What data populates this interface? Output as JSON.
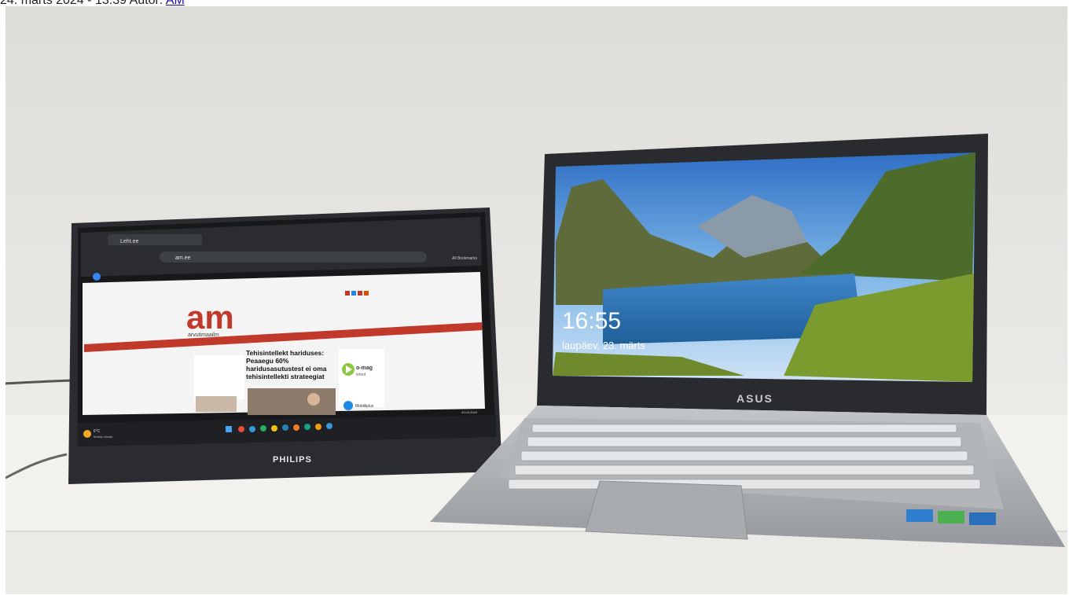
{
  "article_meta": {
    "date_text": "24. märts 2024",
    "separator": " - ",
    "time_text": "13:39",
    "author_label": "Autor:",
    "author_link": "AM"
  },
  "photo": {
    "monitor": {
      "brand": "PHILIPS",
      "browser": {
        "tab_title": "Leht.ee",
        "address": "am.ee",
        "bookmarks_label": "All Bookmarks"
      },
      "website": {
        "logo_text": "am",
        "logo_subtitle": "arvutimaailm",
        "headline": "Tehisintellekt hariduses: Peaaegu 60% haridusasutustest ei oma tehisintellekti strateegiat",
        "ad_label": "o-mag",
        "ad_sub": "lehed",
        "side_link": "Mobiiliplus"
      },
      "taskbar": {
        "weather_temp": "6°C",
        "weather_desc": "Mostly cloudy",
        "clock_time": "14:51",
        "clock_date": "23.03.2024"
      }
    },
    "laptop": {
      "brand": "ASUS",
      "lockscreen_time": "16:55",
      "lockscreen_date": "laupäev, 23. märts"
    }
  },
  "colors": {
    "wall": "#e9e8e6",
    "shelf": "#f3f2ef",
    "laptop_body": "#a8abae",
    "screen_sky": "#4a90d9",
    "site_red": "#c0392b"
  }
}
